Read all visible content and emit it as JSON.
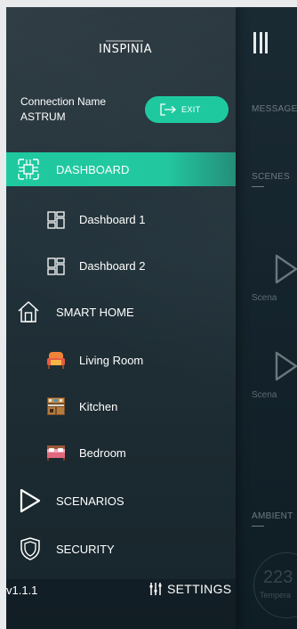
{
  "brand": {
    "logo_text": "INSPINIA"
  },
  "connection": {
    "label": "Connection Name",
    "name": "ASTRUM"
  },
  "exit_button": {
    "label": "EXIT"
  },
  "nav": {
    "dashboard": "DASHBOARD",
    "dashboard_1": "Dashboard 1",
    "dashboard_2": "Dashboard 2",
    "smart_home": "SMART HOME",
    "living_room": "Living Room",
    "kitchen": "Kitchen",
    "bedroom": "Bedroom",
    "scenarios": "SCENARIOS",
    "security": "SECURITY"
  },
  "footer": {
    "version": "v1.1.1",
    "settings": "SETTINGS"
  },
  "main": {
    "tabs": [
      "MESSAGES",
      "SCENES"
    ],
    "scene_label": "Scena",
    "section": "AMBIENT",
    "gauge_value": "223",
    "gauge_label": "Tempera"
  },
  "colors": {
    "accent": "#1fc9a0",
    "sidebar_bg": "#1d2b33",
    "text": "#ffffff"
  },
  "icons": [
    "dashboard-icon",
    "tile-icon",
    "home-icon",
    "sofa-icon",
    "kitchen-icon",
    "bed-icon",
    "play-icon",
    "shield-icon",
    "sliders-icon",
    "menu-icon",
    "logout-icon"
  ]
}
